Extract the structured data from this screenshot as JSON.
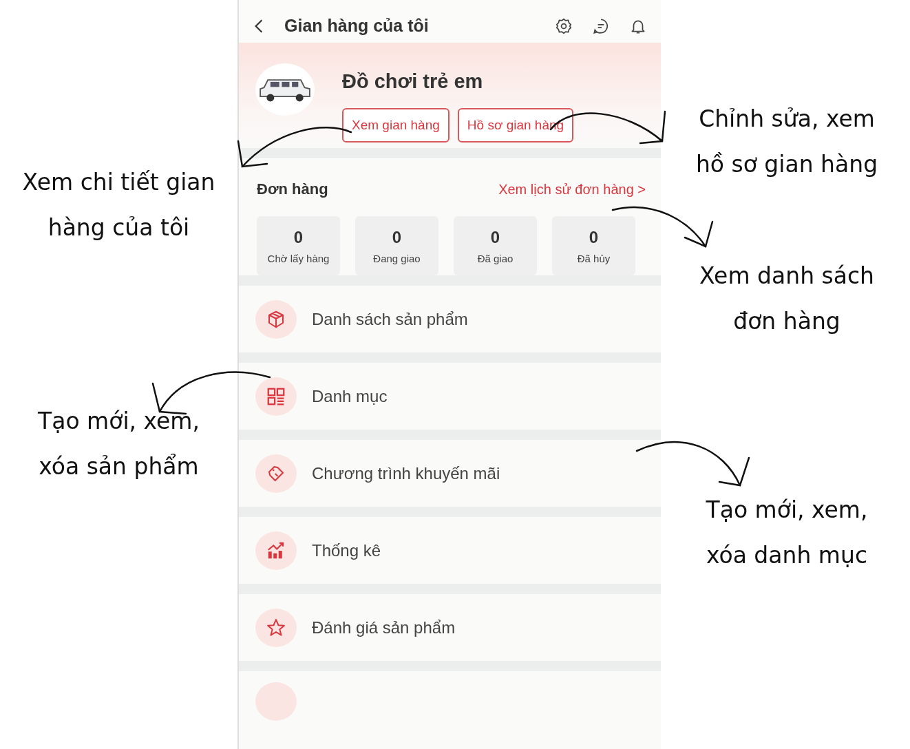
{
  "header": {
    "title": "Gian hàng của tôi"
  },
  "shop": {
    "name": "Đồ chơi trẻ em",
    "buttons": [
      "Xem gian hàng",
      "Hồ sơ gian hàng"
    ]
  },
  "orders": {
    "title": "Đơn hàng",
    "history_link": "Xem lịch sử đơn hàng >",
    "stats": [
      {
        "count": "0",
        "label": "Chờ lấy hàng"
      },
      {
        "count": "0",
        "label": "Đang giao"
      },
      {
        "count": "0",
        "label": "Đã giao"
      },
      {
        "count": "0",
        "label": "Đã hủy"
      }
    ]
  },
  "menu": [
    "Danh sách sản phẩm",
    "Danh mục",
    "Chương trình khuyến mãi",
    "Thống kê",
    "Đánh giá sản phẩm"
  ],
  "annotations_left": [
    "Xem chi tiết gian\nhàng của tôi",
    "Tạo mới, xem,\nxóa sản phẩm"
  ],
  "annotations_right": [
    "Chỉnh sửa, xem\nhồ sơ gian hàng",
    "Xem danh sách\nđơn hàng",
    "Tạo mới, xem,\nxóa danh mục"
  ]
}
